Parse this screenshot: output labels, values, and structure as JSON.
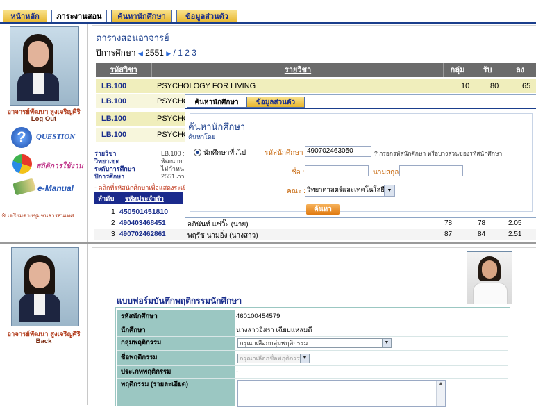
{
  "top_tabs": [
    "หน้าหลัก",
    "ภาระงานสอน",
    "ค้นหานักศึกษา",
    "ข้อมูลส่วนตัว"
  ],
  "teacher": {
    "name": "อาจารย์พัฒนา สูงเจริญศิริ",
    "logout": "Log Out",
    "back": "Back"
  },
  "sidebar": {
    "question": "QUESTION",
    "stats": "สถิติการใช้งาน",
    "manual": "e-Manual",
    "maintenance": "※ เตรียมค่ายชุมชนสารสนเทศ"
  },
  "schedule": {
    "title": "ตารางสอนอาจารย์",
    "year_label": "ปีการศึกษา",
    "year": "2551",
    "terms": "/ 1 2 3",
    "headers": [
      "รหัสวิชา",
      "รายวิชา",
      "กลุ่ม",
      "รับ",
      "ลง"
    ],
    "rows": [
      {
        "code": "LB.100",
        "name": "PSYCHOLOGY FOR LIVING",
        "group": "10",
        "accept": "80",
        "enroll": "65"
      },
      {
        "code": "LB.100",
        "name": "PSYCHO"
      },
      {
        "code": "LB.100",
        "name": "PSYCHO"
      },
      {
        "code": "LB.100",
        "name": "PSYCHO"
      }
    ]
  },
  "course_info": {
    "labels": [
      "รายวิชา",
      "วิทยาเขต",
      "ระดับการศึกษา",
      "ปีการศึกษา"
    ],
    "values": [
      "LB.100 :",
      "พัฒนาการ",
      "ไม่กำหน",
      "2551 ภาค"
    ],
    "hint": "- คลิกที่รหัสนักศึกษาเพื่อแสดงระเบีย",
    "table_headers": [
      "ลำดับ",
      "รหัสประจำตัว"
    ],
    "students": [
      {
        "no": "1",
        "id": "450501451810",
        "name": "",
        "c1": "",
        "c2": "",
        "c3": ""
      },
      {
        "no": "2",
        "id": "490403468451",
        "name": "อภินันท์ แซ่วิ๊ะ (นาย)",
        "c1": "78",
        "c2": "78",
        "c3": "2.05"
      },
      {
        "no": "3",
        "id": "490702462861",
        "name": "พฤรัช นามอิ่ง (นางสาว)",
        "c1": "87",
        "c2": "84",
        "c3": "2.51"
      }
    ]
  },
  "popup": {
    "tabs": [
      "ค้นหานักศึกษา",
      "ข้อมูลส่วนตัว"
    ],
    "title": "ค้นหานักศึกษา",
    "subtitle": "ค้นหาโดย",
    "radio_label": "นักศึกษาทั่วไป",
    "id_label": "รหัสนักศึกษา :",
    "id_value": "490702463050",
    "id_hint": "? กรอกรหัสนักศึกษา หรือบางส่วนของรหัสนักศึกษา",
    "name_label": "ชื่อ :",
    "surname_label": "นามสกุล :",
    "faculty_label": "คณะ :",
    "faculty_value": "วิทยาศาสตร์และเทคโนโลยี",
    "search_button": "ค้นหา"
  },
  "behavior_form": {
    "title": "แบบฟอร์มบันทึกพฤติกรรมนักศึกษา",
    "rows": [
      {
        "label": "รหัสนักศึกษา",
        "value": "460100454579"
      },
      {
        "label": "นักศึกษา",
        "value": "นางสาวอิสรา เฉียบแหลมดี"
      },
      {
        "label": "กลุ่มพฤติกรรม",
        "value": "กรุณาเลือกกลุ่มพฤติกรรม"
      },
      {
        "label": "ชื่อพฤติกรรม",
        "value": "กรุณาเลือกชื่อพฤติกรรม"
      },
      {
        "label": "ประเภทพฤติกรรม",
        "value": "-"
      },
      {
        "label": "พฤติกรรม (รายละเอียด)",
        "value": ""
      }
    ]
  }
}
